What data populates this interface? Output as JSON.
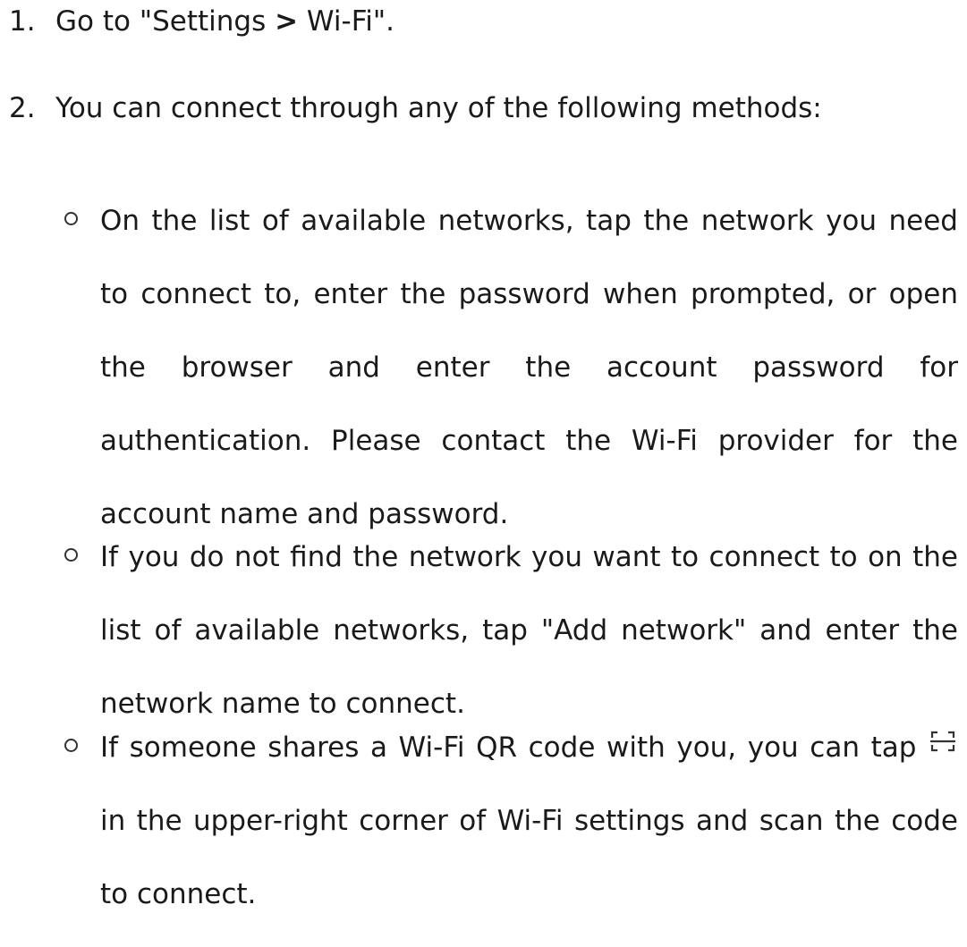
{
  "steps": [
    {
      "number": "1.",
      "text_before": "Go to \"Settings ",
      "separator": ">",
      "text_after": " Wi-Fi\"."
    },
    {
      "number": "2.",
      "text": "You can connect through any of the following methods:"
    }
  ],
  "methods": [
    {
      "text": "On the list of available networks, tap the network you need to connect to, enter the password when prompted, or open the browser and enter the account password for authentication. Please contact the Wi-Fi provider for the account name and password."
    },
    {
      "text": "If you do not find the network you want to connect to on the list of available networks, tap \"Add network\" and enter the network name to connect."
    },
    {
      "text_before": "If someone shares a Wi-Fi QR code with you, you can tap ",
      "icon": "scan-icon",
      "text_after": " in the upper-right corner of Wi-Fi settings and scan the code to connect."
    }
  ]
}
